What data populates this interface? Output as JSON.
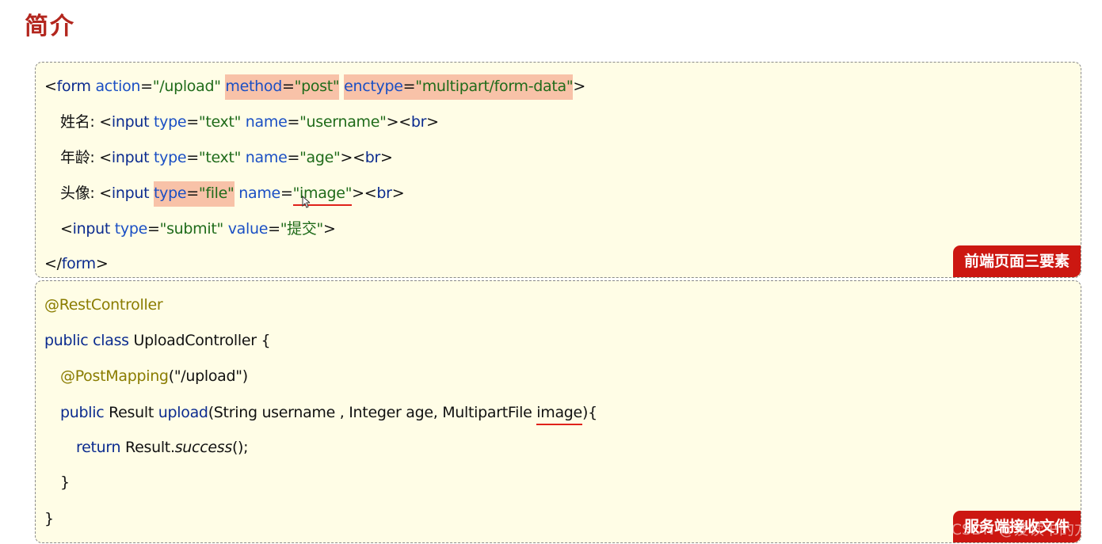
{
  "title": "简介",
  "box1": {
    "tag": "前端页面三要素",
    "l1": {
      "p1": "<",
      "p2": "form ",
      "p3": "action",
      "p4": "=",
      "p5": "\"/upload\"",
      "p6": "method",
      "p7": "=",
      "p8": "\"post\"",
      "p9": "enctype",
      "p10": "=",
      "p11": "\"multipart/form-data\"",
      "p12": ">"
    },
    "l2": {
      "p1": "姓名: <",
      "p2": "input ",
      "p3": "type",
      "p4": "=",
      "p5": "\"text\" ",
      "p6": "name",
      "p7": "=",
      "p8": "\"username\"",
      "p9": "><",
      "p10": "br",
      "p11": ">"
    },
    "l3": {
      "p1": "年龄: <",
      "p2": "input ",
      "p3": "type",
      "p4": "=",
      "p5": "\"text\" ",
      "p6": "name",
      "p7": "=",
      "p8": "\"age\"",
      "p9": "><",
      "p10": "br",
      "p11": ">"
    },
    "l4": {
      "p1": "头像: <",
      "p2": "input ",
      "p3": "type",
      "p4": "=",
      "p5": "\"file\"",
      "p6": "name",
      "p7": "=",
      "p8a": "\"",
      "p8b": "image",
      "p8c": "\"",
      "p9": "><",
      "p10": "br",
      "p11": ">"
    },
    "l5": {
      "p1": "<",
      "p2": "input ",
      "p3": "type",
      "p4": "=",
      "p5": "\"submit\" ",
      "p6": "value",
      "p7": "=",
      "p8": "\"提交\"",
      "p9": ">"
    },
    "l6": {
      "p1": "</",
      "p2": "form",
      "p3": ">"
    }
  },
  "box2": {
    "tag": "服务端接收文件",
    "watermark": "CSDN @爱读书的方",
    "l1": "@RestController",
    "l2": {
      "p1": "public class ",
      "p2": "UploadController {"
    },
    "l3": {
      "p1": "@PostMapping",
      "p2": "(\"/upload\")"
    },
    "l4": {
      "p1": "public ",
      "p2": "Result ",
      "p3": "upload",
      "p4": "(String username , Integer age, MultipartFile ",
      "p5": "image",
      "p6": "){"
    },
    "l5": {
      "p1": "return ",
      "p2": "Result.",
      "p3": "success",
      "p4": "();"
    },
    "l6": "}",
    "l7": "}"
  }
}
